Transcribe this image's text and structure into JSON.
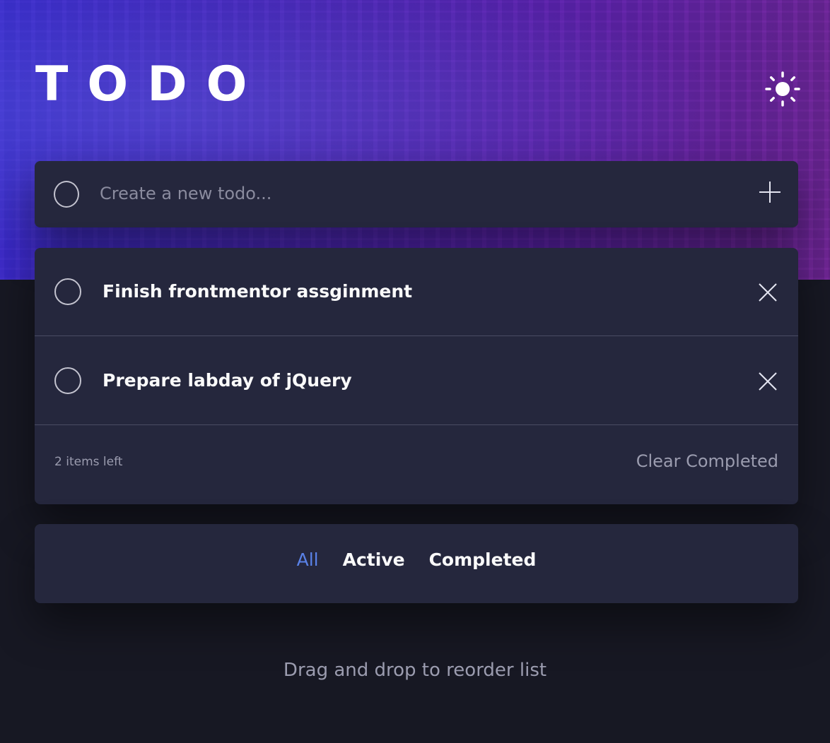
{
  "header": {
    "title": "TODO",
    "theme_icon": "sun-icon"
  },
  "create": {
    "placeholder": "Create a new todo...",
    "add_icon": "plus-icon"
  },
  "todos": [
    {
      "label": "Finish frontmentor assginment",
      "completed": false
    },
    {
      "label": "Prepare labday of jQuery",
      "completed": false
    }
  ],
  "footer": {
    "items_left": "2 items left",
    "clear_label": "Clear Completed"
  },
  "filters": {
    "all": "All",
    "active": "Active",
    "completed": "Completed",
    "selected": "All"
  },
  "hint": "Drag and drop to reorder list",
  "colors": {
    "background": "#171823",
    "card": "#25273d",
    "accent": "#5a82e8",
    "text": "#fafafa",
    "muted": "#9b9caf"
  }
}
